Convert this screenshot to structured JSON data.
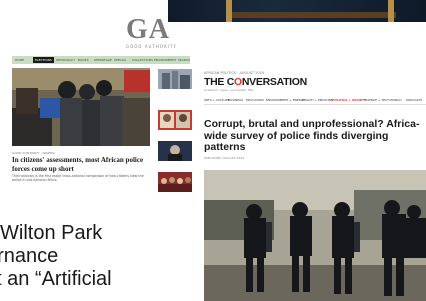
{
  "slide": {
    "line1": "Wilton Park",
    "line2": "ernance",
    "line3": "t an “Artificial"
  },
  "ga": {
    "logo": "GA",
    "subtitle": "GOOD AUTHORITY",
    "nav": [
      "HOME",
      "ELECTIONS",
      "DEMOCRACY",
      "BOOKS",
      "REPORTAGE",
      "SPECIAL",
      "COLLECTIONS",
      "ENVIRONMENT",
      "SEARCH",
      "DONATE"
    ],
    "active_nav": "ELECTIONS",
    "caption": "GOOD AUTHORITY · NIGERIA",
    "headline": "In citizens' assessments, most African police forces come up short",
    "body": "Their analysis is the first major cross-national comparison of how citizens view the police in sub-Saharan Africa"
  },
  "conversation": {
    "meta": "AFRICAN POLITICS · AUGUST 2024",
    "logo_pre": "THE C",
    "logo_o": "O",
    "logo_post": "NVERSATION",
    "tagline": "Academic rigour, journalistic flair",
    "nav": [
      "ARTS + CULTURE",
      "BUSINESS",
      "EDUCATION",
      "ENVIRONMENT + ENERGY",
      "HEALTH + MEDICINE",
      "POLITICS + SOCIETY",
      "SCIENCE + TECH",
      "WORLD",
      "PODCASTS"
    ],
    "active_nav": "POLITICS + SOCIETY",
    "headline": "Corrupt, brutal and unprofessional? Africa-wide survey of police finds diverging patterns",
    "byline": "PUBLISHED: AUGUST 2024"
  }
}
